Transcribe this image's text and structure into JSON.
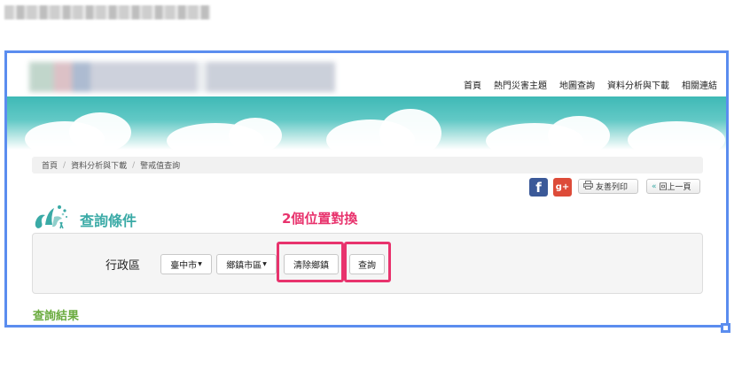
{
  "topnav": [
    "首頁",
    "熱門災害主題",
    "地圖查詢",
    "資料分析與下載",
    "相關連結"
  ],
  "breadcrumb": {
    "home": "首頁",
    "analysis": "資料分析與下載",
    "current": "警戒值查詢",
    "separator": "/"
  },
  "social": {
    "facebook": "f",
    "googleplus": "g+"
  },
  "actions": {
    "print": "友善列印",
    "back": "回上一頁"
  },
  "section": {
    "query_title": "查詢條件",
    "result_title": "查詢結果"
  },
  "annotation": "2個位置對換",
  "form": {
    "district_label": "行政區",
    "city_value": "臺中市",
    "township_value": "鄉鎮市區",
    "clear_button": "清除鄉鎮",
    "query_button": "查詢"
  },
  "colors": {
    "accent_teal": "#3aaaa6",
    "annotation_pink": "#e8336d",
    "frame_blue": "#5b8def",
    "result_green": "#6aab3f"
  }
}
